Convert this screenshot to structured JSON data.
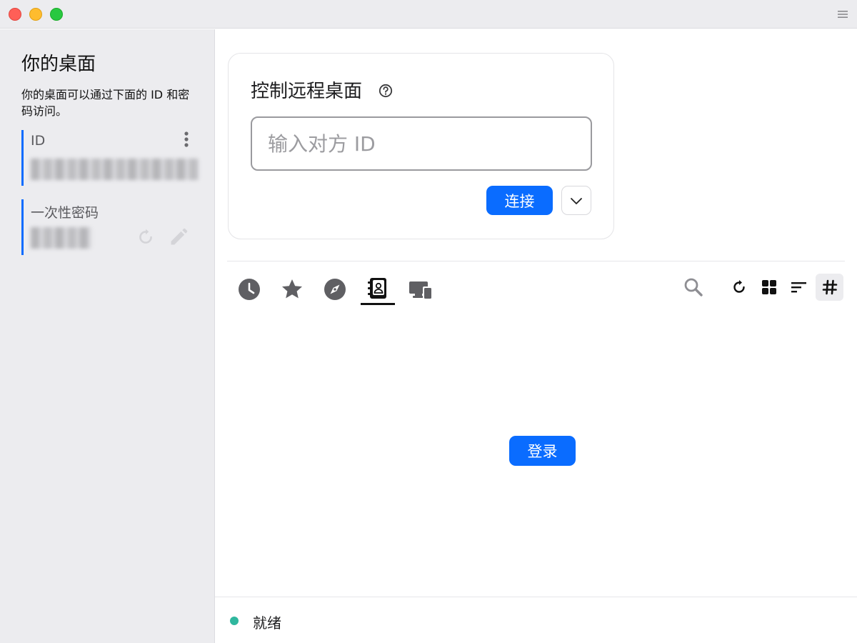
{
  "sidebar": {
    "title": "你的桌面",
    "description": "你的桌面可以通过下面的 ID 和密码访问。",
    "id_label": "ID",
    "password_label": "一次性密码"
  },
  "connect": {
    "title": "控制远程桌面",
    "id_placeholder": "输入对方 ID",
    "connect_label": "连接"
  },
  "tabs": [
    {
      "icon": "clock-icon",
      "name": "recent"
    },
    {
      "icon": "star-icon",
      "name": "favorites"
    },
    {
      "icon": "compass-icon",
      "name": "discovered"
    },
    {
      "icon": "address-book-icon",
      "name": "address-book",
      "active": true
    },
    {
      "icon": "devices-icon",
      "name": "group"
    }
  ],
  "toolbar": {
    "icons": [
      "search-icon",
      "refresh-icon",
      "grid-view-icon",
      "sort-icon",
      "hash-icon"
    ],
    "active": "hash-icon"
  },
  "login_label": "登录",
  "status": {
    "text": "就绪",
    "color": "#2fb79e"
  },
  "colors": {
    "accent": "#0a6cff"
  }
}
